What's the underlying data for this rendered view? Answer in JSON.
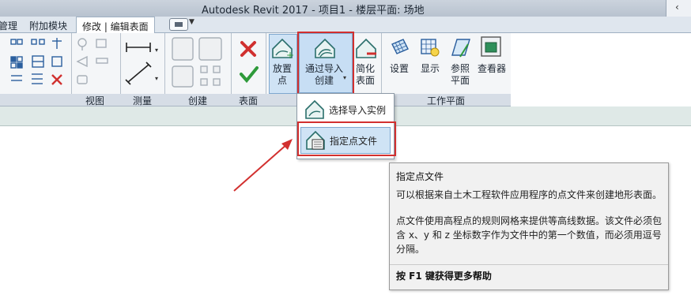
{
  "window": {
    "title": "Autodesk Revit 2017 -     项目1 - 楼层平面: 场地"
  },
  "tabs": [
    {
      "label": "管理"
    },
    {
      "label": "附加模块"
    },
    {
      "label": "修改 | 编辑表面",
      "active": true
    }
  ],
  "ribbon": {
    "panels": {
      "view": "视图",
      "measure": "测量",
      "create": "创建",
      "surface": "表面",
      "workplane": "工作平面"
    },
    "buttons": {
      "place_point": "放置\n点",
      "create_from_import": "通过导入\n创建",
      "simplify_surface": "简化\n表面",
      "set": "设置",
      "show": "显示",
      "ref_plane": "参照\n平面",
      "viewer": "查看器"
    }
  },
  "dropdown": {
    "items": [
      {
        "label": "选择导入实例"
      },
      {
        "label": "指定点文件"
      }
    ]
  },
  "tooltip": {
    "title": "指定点文件",
    "desc": "可以根据来自土木工程软件应用程序的点文件来创建地形表面。",
    "detail": "点文件使用高程点的规则网格来提供等高线数据。该文件必须包含 x、y 和 z 坐标数字作为文件中的第一个数值，而必须用逗号分隔。",
    "help": "按 F1 键获得更多帮助"
  },
  "colors": {
    "highlight": "#d2302f",
    "accent": "#2a7f7a"
  }
}
